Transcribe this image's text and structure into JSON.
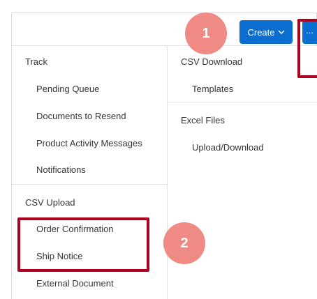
{
  "toolbar": {
    "create_label": "Create",
    "more_label": "..."
  },
  "menu": {
    "left": {
      "track_header": "Track",
      "track_items": [
        "Pending Queue",
        "Documents to Resend",
        "Product Activity Messages",
        "Notifications"
      ],
      "csv_upload_header": "CSV Upload",
      "csv_upload_items": [
        "Order Confirmation",
        "Ship Notice",
        "External Document"
      ]
    },
    "right": {
      "csv_download_header": "CSV Download",
      "csv_download_items": [
        "Templates"
      ],
      "excel_header": "Excel Files",
      "excel_items": [
        "Upload/Download"
      ]
    }
  },
  "annotations": {
    "badge_1": "1",
    "badge_2": "2",
    "badge_color": "#ef8a85",
    "highlight_color": "#b00020"
  },
  "colors": {
    "primary_button": "#0a6ed1",
    "text": "#32363a",
    "divider": "#e2e2e2"
  }
}
